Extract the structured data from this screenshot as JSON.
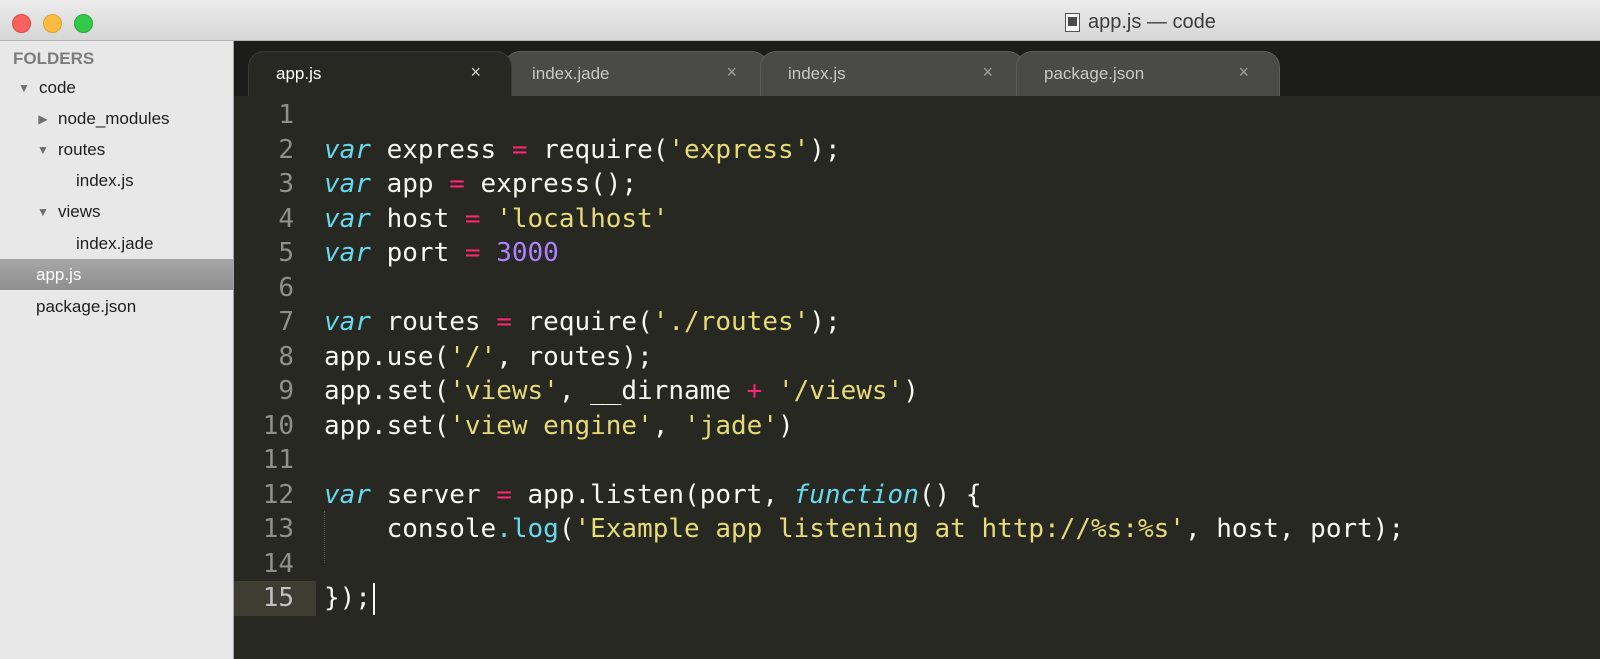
{
  "window": {
    "title": "app.js — code"
  },
  "sidebar": {
    "header": "FOLDERS",
    "items": [
      {
        "label": "code",
        "arrow": "▼",
        "indent": 0,
        "selected": false
      },
      {
        "label": "node_modules",
        "arrow": "▶",
        "indent": 1,
        "selected": false
      },
      {
        "label": "routes",
        "arrow": "▼",
        "indent": 1,
        "selected": false
      },
      {
        "label": "index.js",
        "arrow": "",
        "indent": 2,
        "selected": false
      },
      {
        "label": "views",
        "arrow": "▼",
        "indent": 1,
        "selected": false
      },
      {
        "label": "index.jade",
        "arrow": "",
        "indent": 2,
        "selected": false
      },
      {
        "label": "app.js",
        "arrow": "",
        "indent": 1,
        "selected": true
      },
      {
        "label": "package.json",
        "arrow": "",
        "indent": 1,
        "selected": false
      }
    ]
  },
  "tabs": [
    {
      "label": "app.js",
      "close": "×",
      "active": true
    },
    {
      "label": "index.jade",
      "close": "×",
      "active": false
    },
    {
      "label": "index.js",
      "close": "×",
      "active": false
    },
    {
      "label": "package.json",
      "close": "×",
      "active": false
    }
  ],
  "editor": {
    "current_line": 15,
    "lines": [
      {
        "num": "1",
        "tokens": []
      },
      {
        "num": "2",
        "tokens": [
          [
            "kw",
            "var"
          ],
          [
            "plain",
            " express "
          ],
          [
            "op",
            "="
          ],
          [
            "plain",
            " require("
          ],
          [
            "str",
            "'express'"
          ],
          [
            "plain",
            ");"
          ]
        ]
      },
      {
        "num": "3",
        "tokens": [
          [
            "kw",
            "var"
          ],
          [
            "plain",
            " app "
          ],
          [
            "op",
            "="
          ],
          [
            "plain",
            " express();"
          ]
        ]
      },
      {
        "num": "4",
        "tokens": [
          [
            "kw",
            "var"
          ],
          [
            "plain",
            " host "
          ],
          [
            "op",
            "="
          ],
          [
            "plain",
            " "
          ],
          [
            "str",
            "'localhost'"
          ]
        ]
      },
      {
        "num": "5",
        "tokens": [
          [
            "kw",
            "var"
          ],
          [
            "plain",
            " port "
          ],
          [
            "op",
            "="
          ],
          [
            "plain",
            " "
          ],
          [
            "num",
            "3000"
          ]
        ]
      },
      {
        "num": "6",
        "tokens": []
      },
      {
        "num": "7",
        "tokens": [
          [
            "kw",
            "var"
          ],
          [
            "plain",
            " routes "
          ],
          [
            "op",
            "="
          ],
          [
            "plain",
            " require("
          ],
          [
            "str",
            "'./routes'"
          ],
          [
            "plain",
            ");"
          ]
        ]
      },
      {
        "num": "8",
        "tokens": [
          [
            "plain",
            "app.use("
          ],
          [
            "str",
            "'/'"
          ],
          [
            "plain",
            ", routes);"
          ]
        ]
      },
      {
        "num": "9",
        "tokens": [
          [
            "plain",
            "app.set("
          ],
          [
            "str",
            "'views'"
          ],
          [
            "plain",
            ", __dirname "
          ],
          [
            "op",
            "+"
          ],
          [
            "plain",
            " "
          ],
          [
            "str",
            "'/views'"
          ],
          [
            "plain",
            ")"
          ]
        ]
      },
      {
        "num": "10",
        "tokens": [
          [
            "plain",
            "app.set("
          ],
          [
            "str",
            "'view engine'"
          ],
          [
            "plain",
            ", "
          ],
          [
            "str",
            "'jade'"
          ],
          [
            "plain",
            ")"
          ]
        ]
      },
      {
        "num": "11",
        "tokens": []
      },
      {
        "num": "12",
        "tokens": [
          [
            "kw",
            "var"
          ],
          [
            "plain",
            " server "
          ],
          [
            "op",
            "="
          ],
          [
            "plain",
            " app.listen(port, "
          ],
          [
            "fn",
            "function"
          ],
          [
            "plain",
            "() {"
          ]
        ]
      },
      {
        "num": "13",
        "tokens": [
          [
            "plain",
            "    console"
          ],
          [
            "prop",
            ".log"
          ],
          [
            "plain",
            "("
          ],
          [
            "str",
            "'Example app listening at http://%s:%s'"
          ],
          [
            "plain",
            ", host, port);"
          ]
        ]
      },
      {
        "num": "14",
        "tokens": []
      },
      {
        "num": "15",
        "tokens": [
          [
            "plain",
            "});"
          ]
        ]
      }
    ]
  },
  "colors": {
    "editor_bg": "#272822",
    "keyword": "#66d9ef",
    "operator": "#f92672",
    "string": "#e6db74",
    "number": "#ae81ff",
    "text": "#f8f8f2"
  },
  "icons": {
    "close_window": "close-window-icon",
    "minimize_window": "minimize-window-icon",
    "zoom_window": "zoom-window-icon",
    "document": "document-icon",
    "tab_close": "close-icon",
    "folder_open": "chevron-down-icon",
    "folder_closed": "chevron-right-icon"
  }
}
